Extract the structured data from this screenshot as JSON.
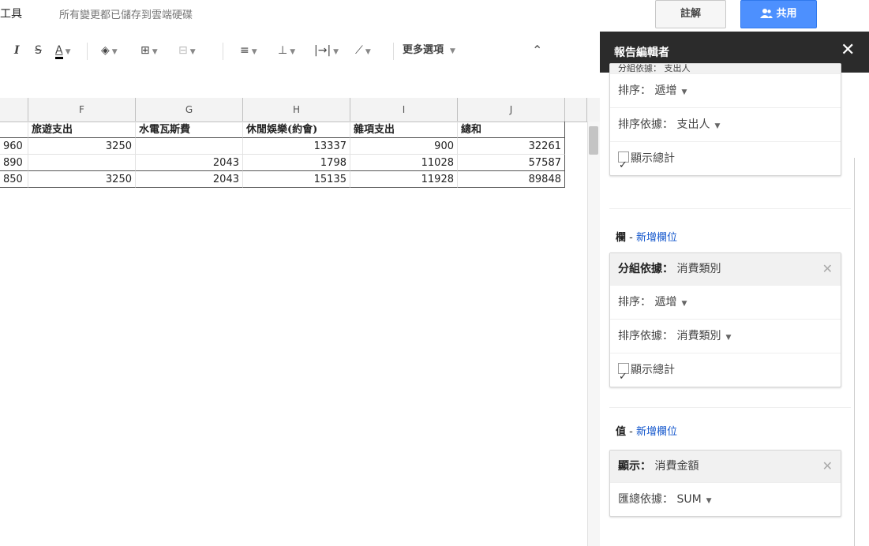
{
  "menu": {
    "tools": "工具",
    "save_status": "所有變更都已儲存到雲端硬碟"
  },
  "buttons": {
    "comments": "註解",
    "share": "共用"
  },
  "toolbar": {
    "italic": "I",
    "strike": "S",
    "text_color": "A",
    "more": "更多選項"
  },
  "grid": {
    "columns": [
      "F",
      "G",
      "H",
      "I",
      "J"
    ],
    "header_row": [
      "旅遊支出",
      "水電瓦斯費",
      "休閒娛樂(約會)",
      "雜項支出",
      "總和"
    ],
    "rows": [
      {
        "e": "960",
        "f": "3250",
        "g": "",
        "h": "13337",
        "i": "900",
        "j": "32261"
      },
      {
        "e": "890",
        "f": "",
        "g": "2043",
        "h": "1798",
        "i": "11028",
        "j": "57587"
      },
      {
        "e": "850",
        "f": "3250",
        "g": "2043",
        "h": "15135",
        "i": "11928",
        "j": "89848"
      }
    ]
  },
  "panel": {
    "title": "報告編輯者",
    "rows_card": {
      "head_partial": "分組依據： 支出人",
      "sort": "排序： 遞增",
      "sort_by": "排序依據： 支出人",
      "show_totals": "顯示總計"
    },
    "columns_section": {
      "label": "欄",
      "sep": " - ",
      "add": "新增欄位"
    },
    "columns_card": {
      "group_label": "分組依據：",
      "group_value": "消費類別",
      "sort": "排序： 遞增",
      "sort_by": "排序依據： 消費類別",
      "show_totals": "顯示總計"
    },
    "values_section": {
      "label": "值",
      "sep": " - ",
      "add": "新增欄位"
    },
    "values_card": {
      "show_label": "顯示：",
      "show_value": "消費金額",
      "summarize": "匯總依據： SUM"
    }
  }
}
